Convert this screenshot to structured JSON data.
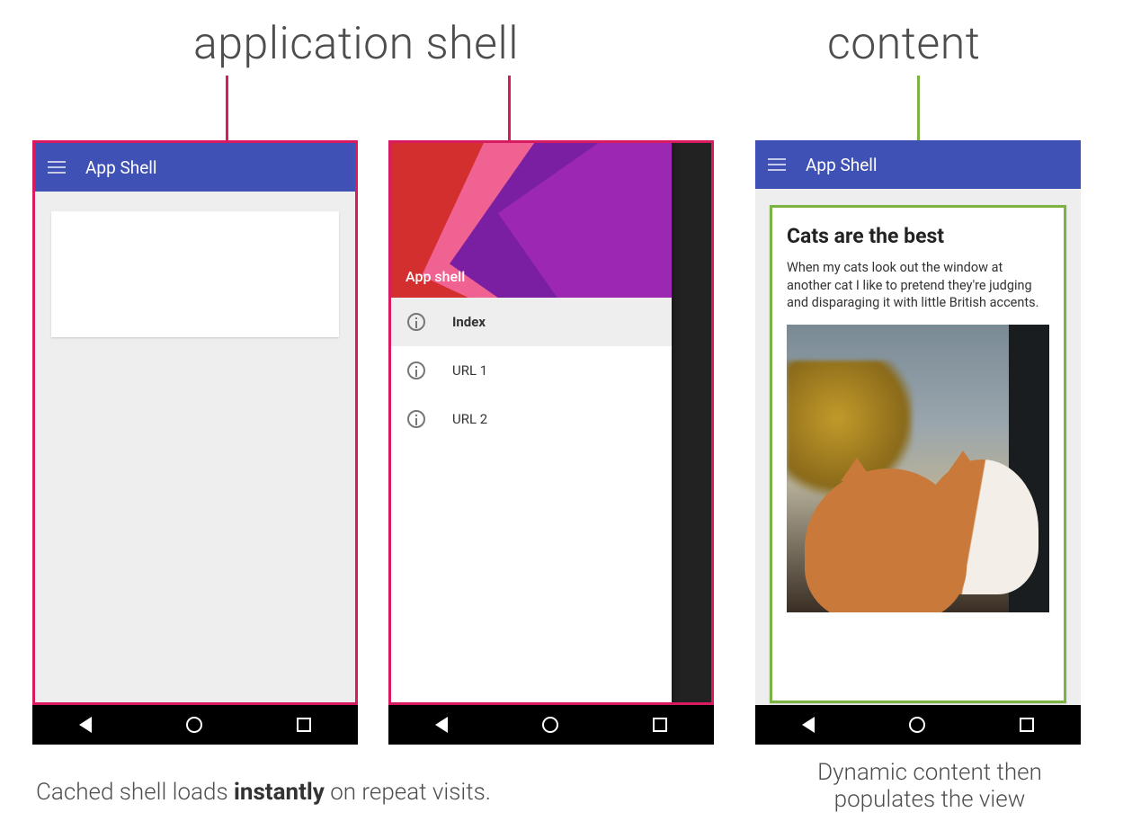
{
  "labels": {
    "top_left": "application shell",
    "top_right": "content"
  },
  "colors": {
    "outline_pink": "#d81b60",
    "outline_green": "#7cb342",
    "appbar": "#3f51b5"
  },
  "phone1": {
    "appbar_title": "App Shell"
  },
  "phone2": {
    "drawer_title": "App shell",
    "items": [
      {
        "label": "Index",
        "active": true
      },
      {
        "label": "URL 1",
        "active": false
      },
      {
        "label": "URL 2",
        "active": false
      }
    ]
  },
  "phone3": {
    "appbar_title": "App Shell",
    "card_title": "Cats are the best",
    "card_body": "When my cats look out the window at another cat I like to pretend they're judging and disparaging it with little British accents."
  },
  "captions": {
    "left_pre": "Cached shell loads ",
    "left_bold": "instantly",
    "left_post": " on repeat visits.",
    "right_line1": "Dynamic content then",
    "right_line2": "populates the view"
  }
}
